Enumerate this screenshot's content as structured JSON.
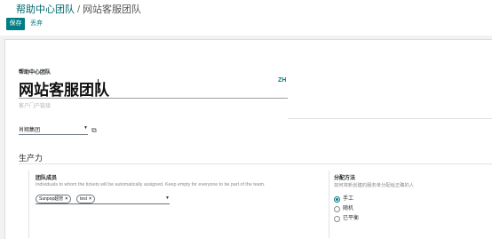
{
  "breadcrumb": {
    "parent": "帮助中心团队",
    "separator": "/",
    "current": "网站客服团队"
  },
  "toolbar": {
    "save_label": "保存",
    "discard_label": "丢弃"
  },
  "form": {
    "name_label": "帮助中心团队",
    "name_value": "网站客服团队",
    "lang_badge": "ZH",
    "portal_hint": "客户门户链接",
    "company_value": "肖翔集团",
    "section_title": "生产力",
    "members": {
      "label": "团队成员",
      "hint": "Individuals to whom the tickets will be automatically assigned. Keep empty for everyone to be part of the team.",
      "tags": [
        {
          "label": "Sunpop超管"
        },
        {
          "label": "test"
        }
      ]
    },
    "assignment": {
      "label": "分配方法",
      "hint": "如何将新创建的服务单分配给正确的人",
      "options": [
        {
          "label": "手工",
          "checked": true
        },
        {
          "label": "随机",
          "checked": false
        },
        {
          "label": "已平衡",
          "checked": false
        }
      ]
    }
  },
  "colors": {
    "accent": "#017e84",
    "link": "#01666b"
  }
}
